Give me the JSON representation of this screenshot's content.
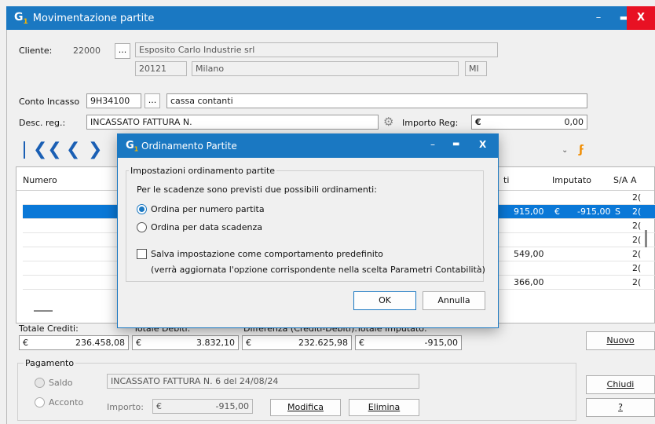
{
  "window": {
    "title": "Movimentazione partite",
    "logo": "G",
    "colors": {
      "titlebar": "#1a78c2",
      "close": "#e81123",
      "selection": "#0a78d7"
    }
  },
  "cliente": {
    "label": "Cliente:",
    "code": "22000",
    "ellipsis": "...",
    "name": "Esposito Carlo Industrie srl",
    "cap": "20121",
    "city": "Milano",
    "province": "MI"
  },
  "conto": {
    "label": "Conto Incasso",
    "code": "9H34100",
    "ellipsis": "...",
    "desc": "cassa contanti"
  },
  "desc_reg": {
    "label": "Desc. reg.:",
    "value": "INCASSATO FATTURA N.",
    "importo_label": "Importo Reg:",
    "currency": "€",
    "importo": "0,00"
  },
  "grid": {
    "col_numero": "Numero",
    "col_ti": "ti",
    "col_imputato": "Imputato",
    "col_sa": "S/A",
    "col_a": "A",
    "rows": [
      {
        "a": "2("
      },
      {
        "importo": "915,00",
        "eur": "€",
        "imputato": "-915,00",
        "sa": "S",
        "a": "2("
      },
      {
        "a": "2("
      },
      {
        "a": "2("
      },
      {
        "importo": "549,00",
        "a": "2("
      },
      {
        "a": "2("
      },
      {
        "importo": "366,00",
        "a": "2("
      }
    ]
  },
  "totals": {
    "crediti_label": "Totale Crediti:",
    "debiti_label": "Totale Debiti:",
    "diff_label": "Differenza (Crediti-Debiti):",
    "imputato_label": "Totale Imputato:",
    "currency": "€",
    "crediti": "236.458,08",
    "debiti": "3.832,10",
    "diff": "232.625,98",
    "imputato": "-915,00"
  },
  "pagamento": {
    "label": "Pagamento",
    "saldo": "Saldo",
    "acconto": "Acconto",
    "desc": "INCASSATO FATTURA N. 6 del 24/08/24",
    "importo_label": "Importo:",
    "currency": "€",
    "importo": "-915,00",
    "modifica": "Modifica",
    "elimina": "Elimina"
  },
  "buttons": {
    "nuovo": "Nuovo",
    "chiudi": "Chiudi",
    "help": "?"
  },
  "dialog": {
    "title": "Ordinamento Partite",
    "group": "Impostazioni ordinamento partite",
    "intro": "Per le scadenze sono previsti due possibili ordinamenti:",
    "opt1": "Ordina per numero partita",
    "opt2": "Ordina per data scadenza",
    "selected": "Ordina per numero partita",
    "save": "Salva impostazione come comportamento predefinito",
    "note": "(verrà aggiornata l'opzione corrispondente nella scelta Parametri Contabilità)",
    "ok": "OK",
    "annulla": "Annulla"
  }
}
